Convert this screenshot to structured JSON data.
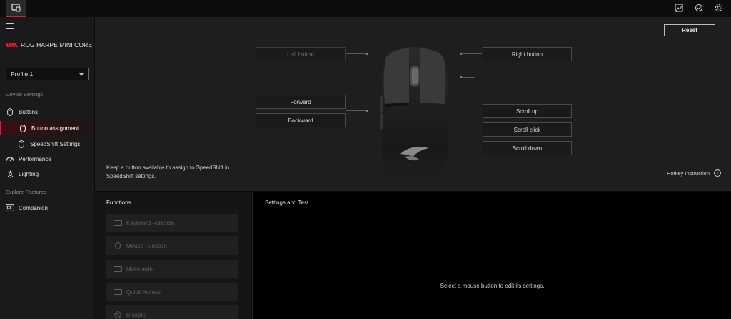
{
  "sidebar": {
    "brand_name": "ROG HARPE MINI CORE",
    "profile": "Profile 1",
    "section_device": "Device Settings",
    "section_explore": "Explore Features",
    "items": {
      "buttons": "Buttons",
      "button_assignment": "Button assignment",
      "speedshift": "SpeedShift Settings",
      "performance": "Performance",
      "lighting": "Lighting",
      "companion": "Companion"
    }
  },
  "main": {
    "reset_label": "Reset",
    "buttons": {
      "left": "Left button",
      "right": "Right button",
      "forward": "Forward",
      "backward": "Backward",
      "scroll_up": "Scroll up",
      "scroll_click": "Scroll click",
      "scroll_down": "Scroll down"
    },
    "hint": "Keep a button available to assign to SpeedShift in SpeedShift settings.",
    "hotkey_label": "Hotkey Instruction"
  },
  "functions": {
    "title": "Functions",
    "items": [
      "Keyboard Function",
      "Mouse Function",
      "Multimedia",
      "Quick Access",
      "Disable"
    ]
  },
  "settings": {
    "title": "Settings and Test",
    "empty_message": "Select a mouse button to edit its settings."
  },
  "colors": {
    "accent": "#e01b2b",
    "background": "#0b0b0b",
    "panel": "#1e1e1e"
  }
}
